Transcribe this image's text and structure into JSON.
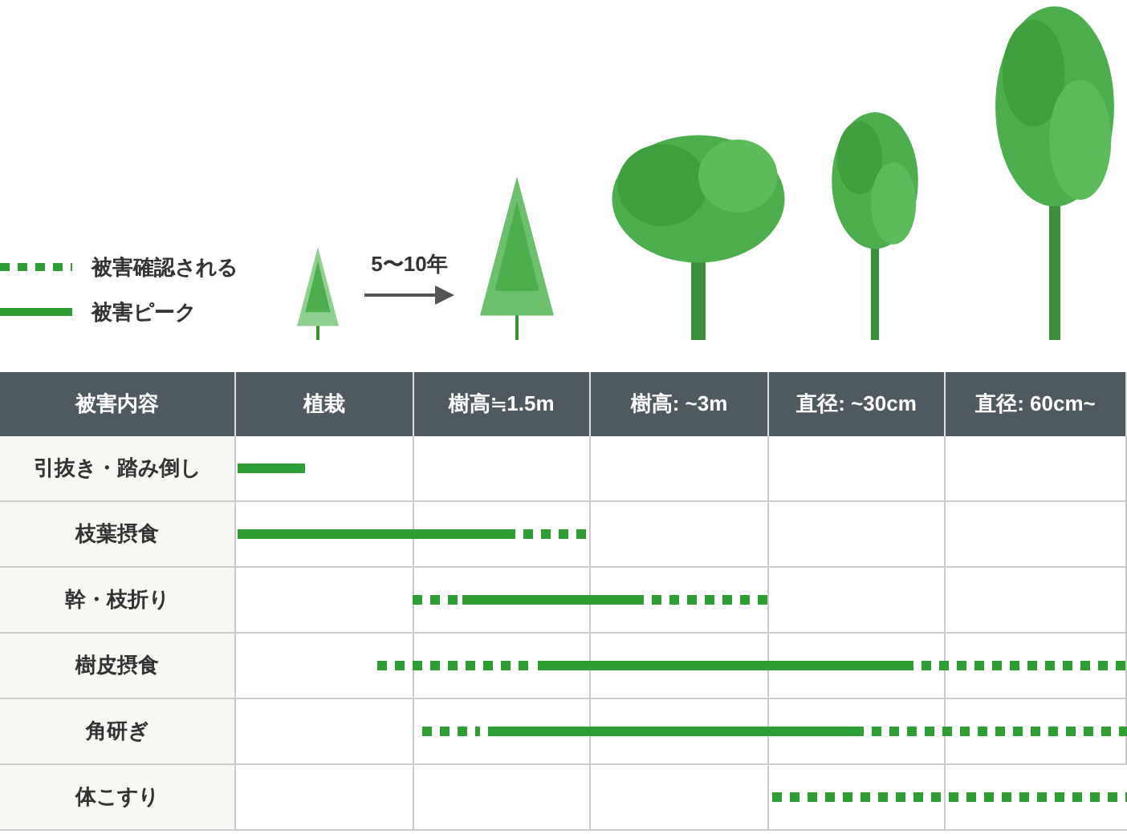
{
  "legend": [
    {
      "kind": "confirmed",
      "label": "被害確認される"
    },
    {
      "kind": "peak",
      "label": "被害ピーク"
    }
  ],
  "growth": {
    "label": "5〜10年"
  },
  "table": {
    "columns": [
      "被害内容",
      "植栽",
      "樹高≒1.5m",
      "樹高: ~3m",
      "直径: ~30cm",
      "直径: 60cm~"
    ],
    "rows": [
      {
        "label": "引抜き・踏み倒し",
        "bars": [
          {
            "kind": "peak"
          }
        ]
      },
      {
        "label": "枝葉摂食",
        "bars": [
          {
            "kind": "peak"
          },
          {
            "kind": "confirmed"
          }
        ]
      },
      {
        "label": "幹・枝折り",
        "bars": [
          {
            "kind": "confirmed"
          },
          {
            "kind": "peak"
          },
          {
            "kind": "confirmed"
          }
        ]
      },
      {
        "label": "樹皮摂食",
        "bars": [
          {
            "kind": "confirmed"
          },
          {
            "kind": "peak"
          },
          {
            "kind": "confirmed"
          }
        ]
      },
      {
        "label": "角研ぎ",
        "bars": [
          {
            "kind": "confirmed"
          },
          {
            "kind": "peak"
          },
          {
            "kind": "confirmed"
          }
        ]
      },
      {
        "label": "体こすり",
        "bars": [
          {
            "kind": "confirmed"
          }
        ]
      }
    ]
  }
}
